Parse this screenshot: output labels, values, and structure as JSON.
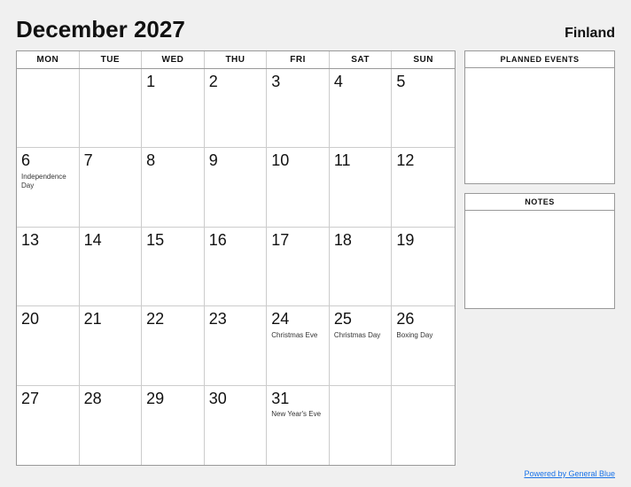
{
  "header": {
    "title": "December 2027",
    "country": "Finland"
  },
  "day_headers": [
    "MON",
    "TUE",
    "WED",
    "THU",
    "FRI",
    "SAT",
    "SUN"
  ],
  "weeks": [
    [
      {
        "day": "",
        "empty": true
      },
      {
        "day": "",
        "empty": true
      },
      {
        "day": "1",
        "event": ""
      },
      {
        "day": "2",
        "event": ""
      },
      {
        "day": "3",
        "event": ""
      },
      {
        "day": "4",
        "event": ""
      },
      {
        "day": "5",
        "event": ""
      }
    ],
    [
      {
        "day": "6",
        "event": "Independence\nDay"
      },
      {
        "day": "7",
        "event": ""
      },
      {
        "day": "8",
        "event": ""
      },
      {
        "day": "9",
        "event": ""
      },
      {
        "day": "10",
        "event": ""
      },
      {
        "day": "11",
        "event": ""
      },
      {
        "day": "12",
        "event": ""
      }
    ],
    [
      {
        "day": "13",
        "event": ""
      },
      {
        "day": "14",
        "event": ""
      },
      {
        "day": "15",
        "event": ""
      },
      {
        "day": "16",
        "event": ""
      },
      {
        "day": "17",
        "event": ""
      },
      {
        "day": "18",
        "event": ""
      },
      {
        "day": "19",
        "event": ""
      }
    ],
    [
      {
        "day": "20",
        "event": ""
      },
      {
        "day": "21",
        "event": ""
      },
      {
        "day": "22",
        "event": ""
      },
      {
        "day": "23",
        "event": ""
      },
      {
        "day": "24",
        "event": "Christmas Eve"
      },
      {
        "day": "25",
        "event": "Christmas Day"
      },
      {
        "day": "26",
        "event": "Boxing Day"
      }
    ],
    [
      {
        "day": "27",
        "event": ""
      },
      {
        "day": "28",
        "event": ""
      },
      {
        "day": "29",
        "event": ""
      },
      {
        "day": "30",
        "event": ""
      },
      {
        "day": "31",
        "event": "New Year's\nEve"
      },
      {
        "day": "",
        "empty": true
      },
      {
        "day": "",
        "empty": true
      }
    ]
  ],
  "sidebar": {
    "planned_events_label": "PLANNED EVENTS",
    "notes_label": "NOTES"
  },
  "footer": {
    "link_text": "Powered by General Blue"
  }
}
